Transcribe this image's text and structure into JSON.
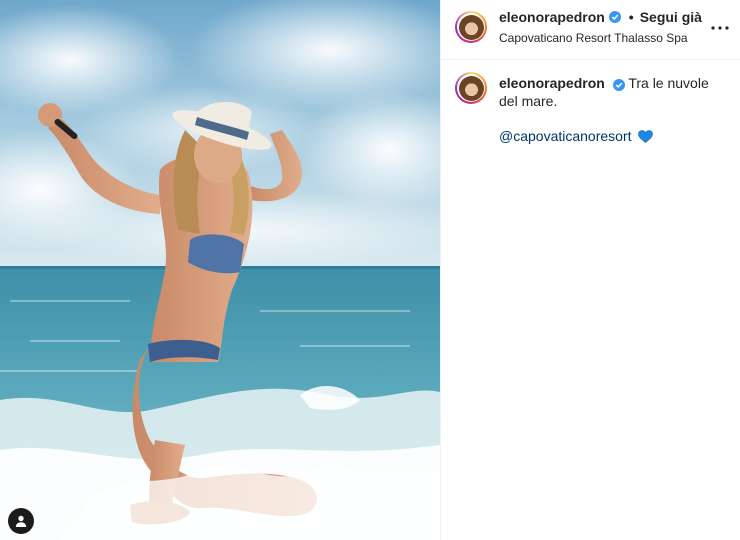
{
  "post": {
    "username": "eleonorapedron",
    "follow_label": "Segui già",
    "location": "Capovaticano Resort Thalasso Spa",
    "caption_text": "Tra le nuvole del mare.",
    "mention": "@capovaticanoresort",
    "mention_emoji": "blue-heart-icon"
  },
  "icons": {
    "verified": "verified-badge-icon",
    "more": "more-options-icon",
    "tagged_user": "user-tag-icon"
  },
  "colors": {
    "verified_blue": "#3897f0",
    "mention_link": "#00376b",
    "heart_blue": "#1e88e5",
    "text": "#262626"
  }
}
